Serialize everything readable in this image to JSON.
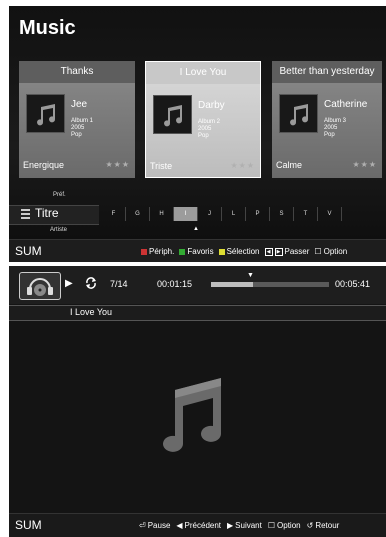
{
  "screen1": {
    "title": "Music",
    "cards": [
      {
        "caption": "Thanks",
        "artist": "Jee",
        "album": "Album 1",
        "year": "2005",
        "genre": "Pop",
        "mood": "Energique",
        "stars": "★★★"
      },
      {
        "caption": "I Love You",
        "artist": "Darby",
        "album": "Album 2",
        "year": "2005",
        "genre": "Pop",
        "mood": "Triste",
        "stars": "★★★"
      },
      {
        "caption": "Better than yesterday",
        "artist": "Catherine",
        "album": "Album 3",
        "year": "2005",
        "genre": "Pop",
        "mood": "Calme",
        "stars": "★★★"
      }
    ],
    "filter": {
      "above": "Préf.",
      "current": "Titre",
      "below": "Artiste"
    },
    "letters": [
      "F",
      "G",
      "H",
      "I",
      "J",
      "L",
      "P",
      "S",
      "T",
      "V"
    ],
    "selected_letter": "I",
    "arrow": "▲",
    "bottom": {
      "sum": "SUM",
      "periph": "Périph.",
      "favoris": "Favoris",
      "selection": "Sélection",
      "passer": "Passer",
      "option": "Option"
    }
  },
  "screen2": {
    "play": "▶",
    "track_count": "7/14",
    "current_time": "00:01:15",
    "total_time": "00:05:41",
    "progress_pct": 36,
    "marker": "▼",
    "song": "I Love You",
    "bottom": {
      "sum": "SUM",
      "pause": "Pause",
      "prev": "Précédent",
      "next": "Suivant",
      "option": "Option",
      "retour": "Retour"
    }
  },
  "colors": {
    "red_button": "#c0c0c0",
    "screen_bg": "#141414",
    "selected": "#bcbcbc"
  }
}
